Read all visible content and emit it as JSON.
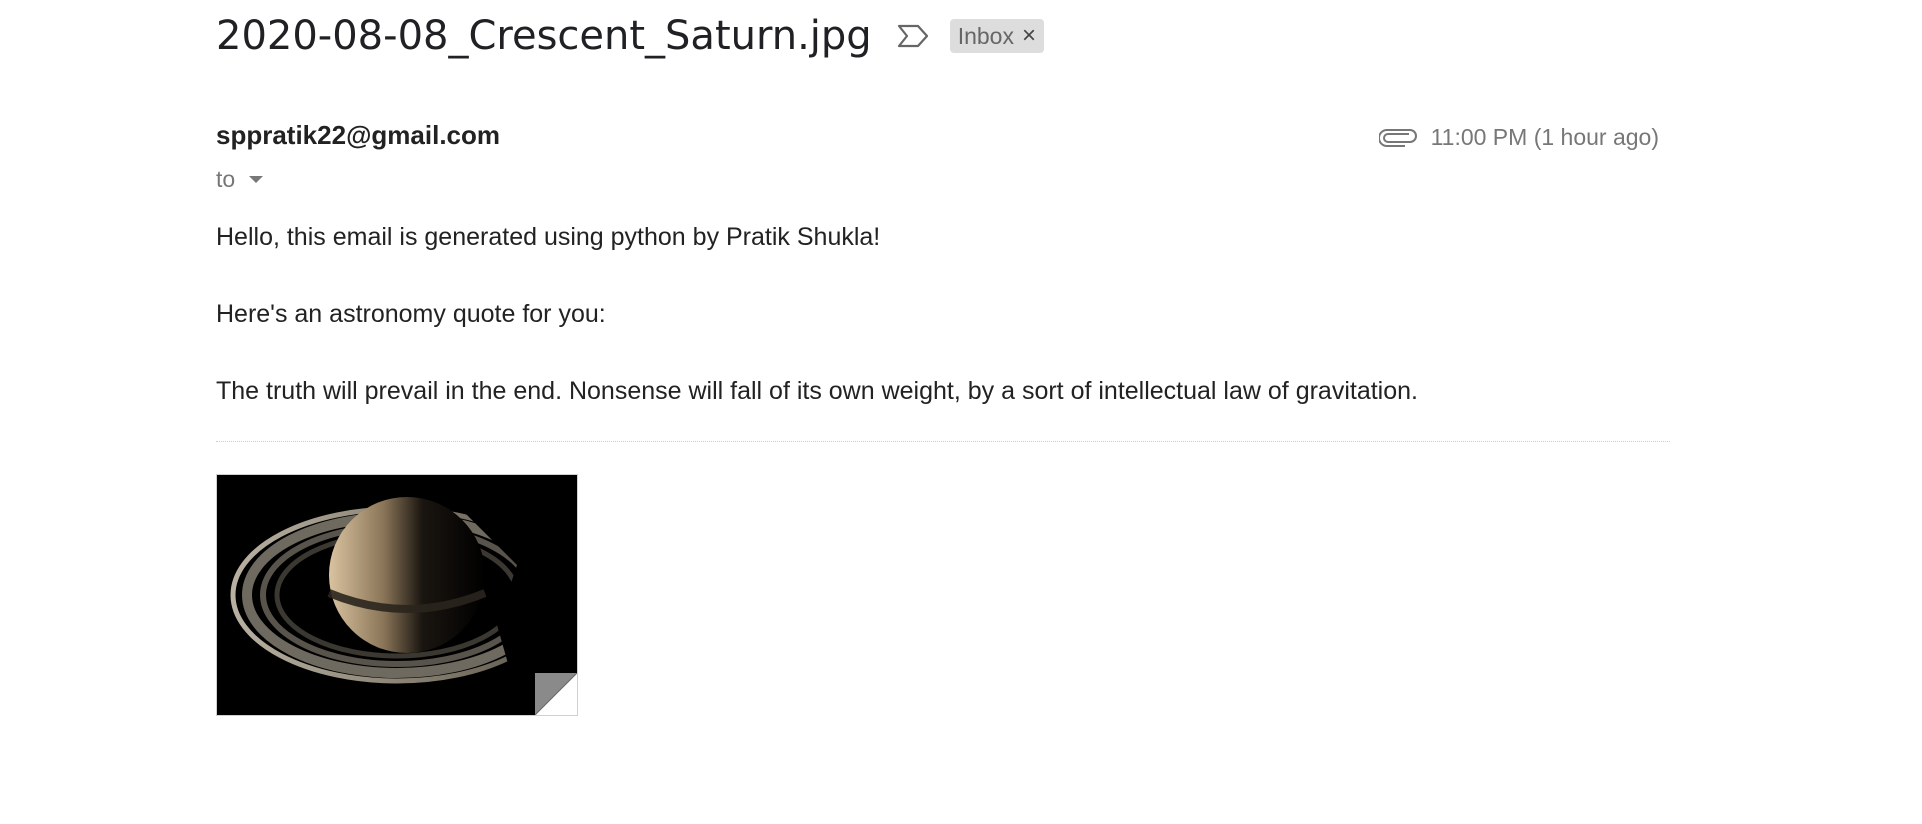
{
  "email": {
    "subject": "2020-08-08_Crescent_Saturn.jpg",
    "label": "Inbox",
    "label_close": "×",
    "sender": "sppratik22@gmail.com",
    "to_label": "to",
    "timestamp": "11:00 PM (1 hour ago)",
    "body": [
      "Hello, this email is generated using python by Pratik Shukla!",
      "Here's an astronomy quote for you:",
      "The truth will prevail in the end. Nonsense will fall of its own weight, by a sort of intellectual law of gravitation."
    ],
    "attachment": {
      "icon": "paperclip-icon",
      "thumbnail": "crescent-saturn-image"
    }
  },
  "icons": {
    "important": "important-marker-icon",
    "caret": "caret-down-icon"
  },
  "colors": {
    "chip_bg": "#dddddd",
    "muted_text": "#777777",
    "body_text": "#222222"
  }
}
